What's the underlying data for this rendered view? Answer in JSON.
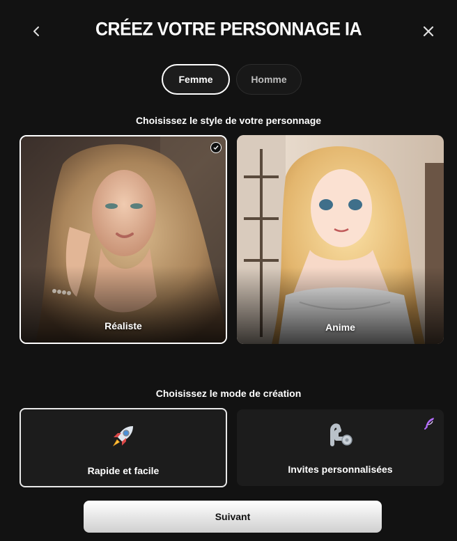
{
  "header": {
    "title": "Créez votre personnage IA",
    "back_icon": "chevron-left-icon",
    "close_icon": "close-icon"
  },
  "gender": {
    "options": [
      "Femme",
      "Homme"
    ],
    "selected": "Femme"
  },
  "style_section": {
    "label": "Choisissez le style de votre personnage",
    "options": [
      {
        "label": "Réaliste",
        "selected": true
      },
      {
        "label": "Anime",
        "selected": false
      }
    ]
  },
  "mode_section": {
    "label": "Choisissez le mode de création",
    "options": [
      {
        "label": "Rapide et facile",
        "icon": "rocket-icon",
        "selected": true
      },
      {
        "label": "Invites personnalisées",
        "icon": "flexed-arm-icon",
        "premium_icon": "premium-feather-icon",
        "selected": false
      }
    ]
  },
  "next_button": "Suivant",
  "colors": {
    "background": "#121212",
    "card": "#1c1c1c",
    "accent_premium": "#b46cff"
  }
}
